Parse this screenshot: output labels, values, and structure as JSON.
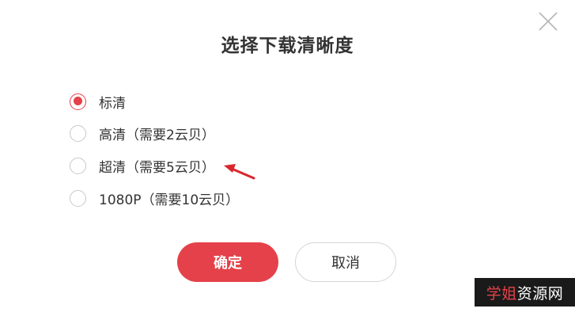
{
  "dialog": {
    "title": "选择下载清晰度",
    "close_icon": "close-icon"
  },
  "options": [
    {
      "label": "标清",
      "checked": true
    },
    {
      "label": "高清（需要2云贝）",
      "checked": false
    },
    {
      "label": "超清（需要5云贝）",
      "checked": false
    },
    {
      "label": "1080P（需要10云贝）",
      "checked": false
    }
  ],
  "annotation": {
    "arrow_icon": "red-arrow-icon",
    "color": "#d9262e"
  },
  "buttons": {
    "confirm_label": "确定",
    "cancel_label": "取消"
  },
  "watermark": {
    "part1": "学姐",
    "part2": "资源网"
  },
  "colors": {
    "accent": "#e5414a",
    "text": "#333333",
    "radio_border": "#c8c8c8"
  }
}
